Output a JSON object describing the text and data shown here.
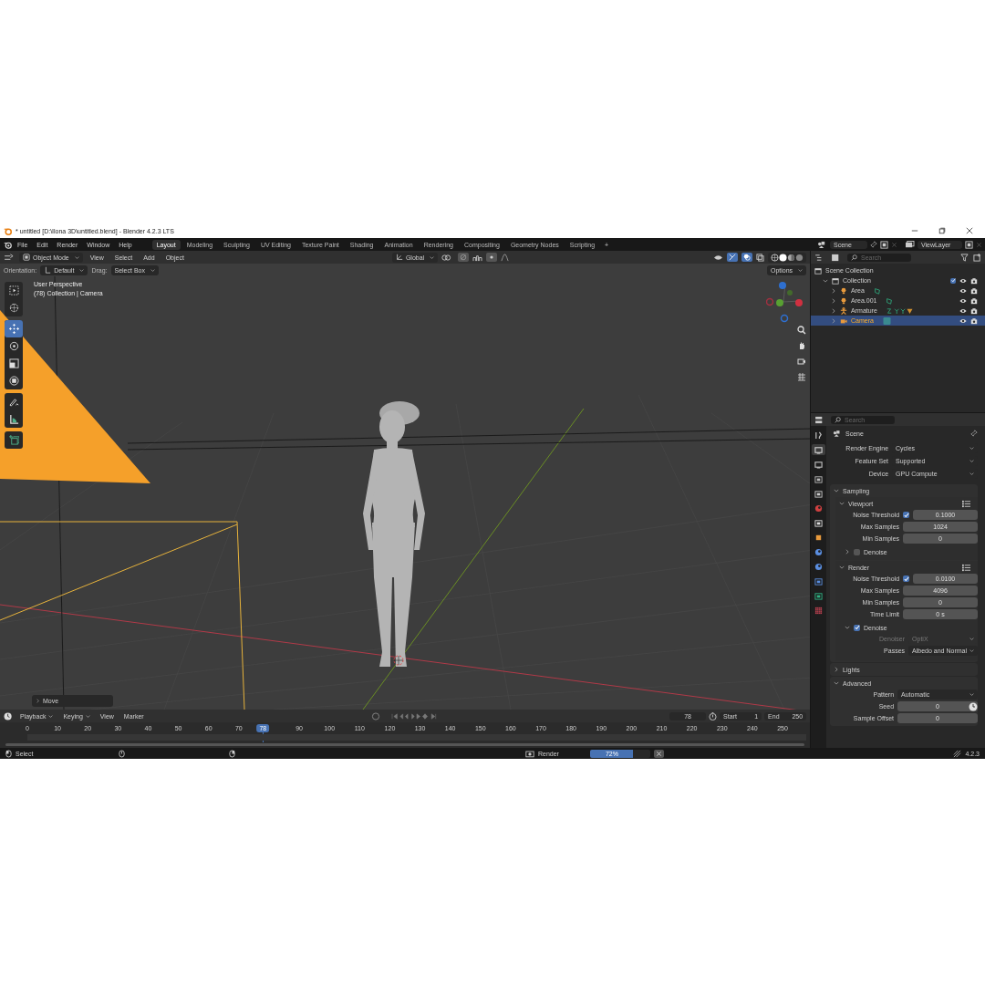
{
  "window": {
    "title": "* untitled [D:\\Ilona 3D\\untitled.blend] - Blender 4.2.3 LTS"
  },
  "menu": [
    "File",
    "Edit",
    "Render",
    "Window",
    "Help"
  ],
  "workspaces": [
    {
      "label": "Layout",
      "selected": true
    },
    {
      "label": "Modeling",
      "selected": false
    },
    {
      "label": "Sculpting",
      "selected": false
    },
    {
      "label": "UV Editing",
      "selected": false
    },
    {
      "label": "Texture Paint",
      "selected": false
    },
    {
      "label": "Shading",
      "selected": false
    },
    {
      "label": "Animation",
      "selected": false
    },
    {
      "label": "Rendering",
      "selected": false
    },
    {
      "label": "Compositing",
      "selected": false
    },
    {
      "label": "Geometry Nodes",
      "selected": false
    },
    {
      "label": "Scripting",
      "selected": false
    }
  ],
  "add_workspace": "+",
  "scene_selector": {
    "scene": "Scene",
    "view_layer": "ViewLayer"
  },
  "viewport_header": {
    "mode": "Object Mode",
    "menus": [
      "View",
      "Select",
      "Add",
      "Object"
    ],
    "orientation": "Global",
    "options": "Options"
  },
  "tool_settings": {
    "orientation_label": "Orientation:",
    "orientation": "Default",
    "drag_label": "Drag:",
    "drag": "Select Box"
  },
  "tool_groups": [
    {
      "tools": [
        {
          "kind": "select_box",
          "selected": false
        },
        {
          "kind": "cursor",
          "selected": false
        }
      ]
    },
    {
      "tools": [
        {
          "kind": "move",
          "selected": true
        },
        {
          "kind": "rotate",
          "selected": false
        },
        {
          "kind": "scale",
          "selected": false
        },
        {
          "kind": "transform",
          "selected": false
        }
      ]
    },
    {
      "tools": [
        {
          "kind": "annotate",
          "selected": false
        },
        {
          "kind": "measure",
          "selected": false
        }
      ]
    },
    {
      "tools": [
        {
          "kind": "add_cube",
          "selected": false
        }
      ]
    }
  ],
  "viewport": {
    "overlay_lines": [
      "User Perspective",
      "(78) Collection | Camera"
    ],
    "operator_panel": "Move"
  },
  "outliner": {
    "search_placeholder": "Search",
    "tree": [
      {
        "label": "Scene Collection",
        "kind": "scene_collection",
        "expanded": true,
        "selected": false,
        "children": [
          {
            "label": "Collection",
            "kind": "collection",
            "expanded": true,
            "checked": true,
            "selected": false,
            "children": [
              {
                "label": "Area",
                "kind": "light",
                "expanded": false,
                "selected": false
              },
              {
                "label": "Area.001",
                "kind": "light",
                "expanded": false,
                "selected": false
              },
              {
                "label": "Armature",
                "kind": "armature",
                "expanded": false,
                "selected": false
              },
              {
                "label": "Camera",
                "kind": "camera",
                "expanded": false,
                "selected": true
              }
            ]
          }
        ]
      }
    ]
  },
  "properties": {
    "search_placeholder": "Search",
    "tabs": [
      {
        "kind": "tool",
        "selected": false
      },
      {
        "kind": "render",
        "selected": true
      },
      {
        "kind": "output",
        "selected": false
      },
      {
        "kind": "view_layer",
        "selected": false
      },
      {
        "kind": "scene",
        "selected": false
      },
      {
        "kind": "world",
        "selected": false
      },
      {
        "kind": "collection",
        "selected": false
      },
      {
        "kind": "object",
        "selected": false
      },
      {
        "kind": "modifiers",
        "selected": false
      },
      {
        "kind": "physics",
        "selected": false
      },
      {
        "kind": "constraints",
        "selected": false
      },
      {
        "kind": "data",
        "selected": false
      },
      {
        "kind": "texture",
        "selected": false
      }
    ],
    "context": "Scene",
    "fields": [
      {
        "kind": "dropdown",
        "label": "Render Engine",
        "value": "Cycles",
        "disabled": false
      },
      {
        "kind": "dropdown",
        "label": "Feature Set",
        "value": "Supported",
        "disabled": false
      },
      {
        "kind": "dropdown",
        "label": "Device",
        "value": "GPU Compute",
        "disabled": false
      }
    ],
    "panels": [
      {
        "label": "Sampling",
        "expanded": true,
        "subpanels": [
          {
            "label": "Viewport",
            "expanded": true,
            "fields": [
              {
                "kind": "check_number",
                "label": "Noise Threshold",
                "checked": true,
                "value": "0.1000",
                "disabled": false
              },
              {
                "kind": "number",
                "label": "Max Samples",
                "value": "1024",
                "disabled": false
              },
              {
                "kind": "number",
                "label": "Min Samples",
                "value": "0",
                "disabled": false
              }
            ],
            "subpanels": [
              {
                "label": "Denoise",
                "expanded": false,
                "checked": false
              }
            ]
          },
          {
            "label": "Render",
            "expanded": true,
            "fields": [
              {
                "kind": "check_number",
                "label": "Noise Threshold",
                "checked": true,
                "value": "0.0100",
                "disabled": false
              },
              {
                "kind": "number",
                "label": "Max Samples",
                "value": "4096",
                "disabled": false
              },
              {
                "kind": "number",
                "label": "Min Samples",
                "value": "0",
                "disabled": false
              },
              {
                "kind": "number",
                "label": "Time Limit",
                "value": "0 s",
                "disabled": false
              }
            ],
            "subpanels": [
              {
                "label": "Denoise",
                "expanded": true,
                "checked": true,
                "fields": [
                  {
                    "kind": "dropdown",
                    "label": "Denoiser",
                    "value": "OptiX",
                    "disabled": true
                  },
                  {
                    "kind": "dropdown",
                    "label": "Passes",
                    "value": "Albedo and Normal",
                    "disabled": false
                  }
                ]
              }
            ]
          }
        ]
      },
      {
        "label": "Lights",
        "expanded": false
      },
      {
        "label": "Advanced",
        "expanded": true,
        "fields": [
          {
            "kind": "dropdown",
            "label": "Pattern",
            "value": "Automatic",
            "disabled": false
          },
          {
            "kind": "number_icon",
            "label": "Seed",
            "value": "0",
            "disabled": false
          },
          {
            "kind": "number",
            "label": "Sample Offset",
            "value": "0",
            "disabled": false
          }
        ]
      }
    ]
  },
  "timeline": {
    "menus": [
      "Playback",
      "Keying",
      "View",
      "Marker"
    ],
    "current_frame": "78",
    "playhead_frame": "78",
    "start_label": "Start",
    "start": "1",
    "end_label": "End",
    "end": "250",
    "ticks": [
      "0",
      "10",
      "20",
      "30",
      "40",
      "50",
      "60",
      "70",
      "90",
      "100",
      "110",
      "120",
      "130",
      "140",
      "150",
      "160",
      "170",
      "180",
      "190",
      "200",
      "210",
      "220",
      "230",
      "240",
      "250"
    ]
  },
  "status_bar": {
    "select": "Select",
    "job": "Render",
    "progress": {
      "level": 0.72,
      "reading": "72%"
    },
    "version": "4.2.3"
  }
}
